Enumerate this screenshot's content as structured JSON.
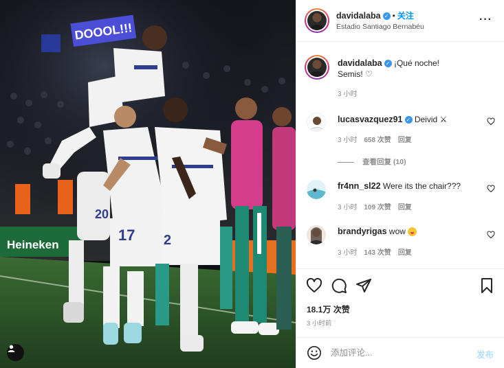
{
  "header": {
    "username": "davidalaba",
    "verified_icon": "verified-badge-icon",
    "follow_label": "关注",
    "location": "Estadio Santiago Bernabéu",
    "more_icon": "more-options-icon"
  },
  "photo": {
    "banner_text": "DOOOL!!!",
    "sponsor_text": "Heineken",
    "jersey_numbers": [
      "17",
      "20",
      "2"
    ],
    "user_tag_icon": "user-tag-icon"
  },
  "caption": {
    "username": "davidalaba",
    "text_line1": "¡Qué noche!",
    "text_line2": "Semis! ♡",
    "time": "3 小时"
  },
  "comments": [
    {
      "username": "lucasvazquez91",
      "verified": true,
      "text": "Deivid",
      "emoji_icon": "crossed-swords-emoji",
      "time": "3 小时",
      "likes": "658 次赞",
      "reply_label": "回复",
      "view_replies": "查看回复 (10)"
    },
    {
      "username": "fr4nn_sl22",
      "verified": false,
      "text": "Were its the chair???",
      "time": "3 小时",
      "likes": "109 次赞",
      "reply_label": "回复"
    },
    {
      "username": "brandyrigas",
      "verified": false,
      "text": "wow",
      "emoji_icon": "savoring-food-emoji",
      "time": "3 小时",
      "likes": "143 次赞",
      "reply_label": "回复"
    }
  ],
  "actions": {
    "like_icon": "heart-icon",
    "comment_icon": "comment-icon",
    "share_icon": "share-icon",
    "save_icon": "bookmark-icon",
    "likes_count": "18.1万 次赞",
    "posted_ago": "3 小时前"
  },
  "add_comment": {
    "placeholder": "添加评论...",
    "post_label": "发布",
    "emoji_icon": "emoji-icon"
  },
  "colors": {
    "accent": "#0095f6",
    "post_disabled": "#b2dffc",
    "muted": "#8e8e8e",
    "pitch": "#2f5a2b",
    "kit_white": "#f2f2f2",
    "pink_vest": "#d63c8c"
  }
}
